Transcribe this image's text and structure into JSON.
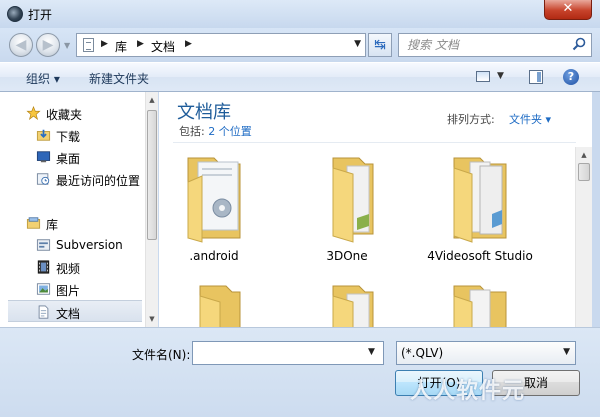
{
  "window": {
    "title": "打开",
    "close_label": "✕"
  },
  "address": {
    "breadcrumbs": [
      "库",
      "文档"
    ],
    "search_placeholder": "搜索 文档"
  },
  "toolbar": {
    "organize_label": "组织 ▾",
    "new_folder_label": "新建文件夹"
  },
  "nav": {
    "items": [
      {
        "label": "收藏夹",
        "icon": "star-icon"
      },
      {
        "label": "下载",
        "icon": "download-folder-icon"
      },
      {
        "label": "桌面",
        "icon": "desktop-icon"
      },
      {
        "label": "最近访问的位置",
        "icon": "recent-places-icon"
      },
      {
        "label": "库",
        "icon": "libraries-icon"
      },
      {
        "label": "Subversion",
        "icon": "subversion-library-icon"
      },
      {
        "label": "视频",
        "icon": "video-library-icon"
      },
      {
        "label": "图片",
        "icon": "pictures-library-icon"
      },
      {
        "label": "文档",
        "icon": "documents-library-icon",
        "selected": true
      }
    ]
  },
  "library": {
    "title": "文档库",
    "includes_prefix": "包括:",
    "includes_link": "2 个位置",
    "arrange_label": "排列方式:",
    "arrange_value": "文件夹 ▾"
  },
  "files": [
    {
      "name": ".android",
      "icon": "folder-with-document-icon"
    },
    {
      "name": "3DOne",
      "icon": "folder-icon"
    },
    {
      "name": "4Videosoft Studio",
      "icon": "folder-with-files-icon"
    },
    {
      "name": "",
      "icon": "folder-icon"
    },
    {
      "name": "",
      "icon": "folder-icon"
    },
    {
      "name": "",
      "icon": "folder-icon"
    }
  ],
  "bottom": {
    "filename_label": "文件名(N):",
    "filename_value": "",
    "filetype_value": "(*.QLV)",
    "open_label": "打开(O)",
    "cancel_label": "取消"
  },
  "watermark": "人人软件元",
  "colors": {
    "library_title": "#1e5c9a",
    "link": "#1e6bc4",
    "folder": "#f5d77c",
    "close_button": "#c7432b"
  }
}
